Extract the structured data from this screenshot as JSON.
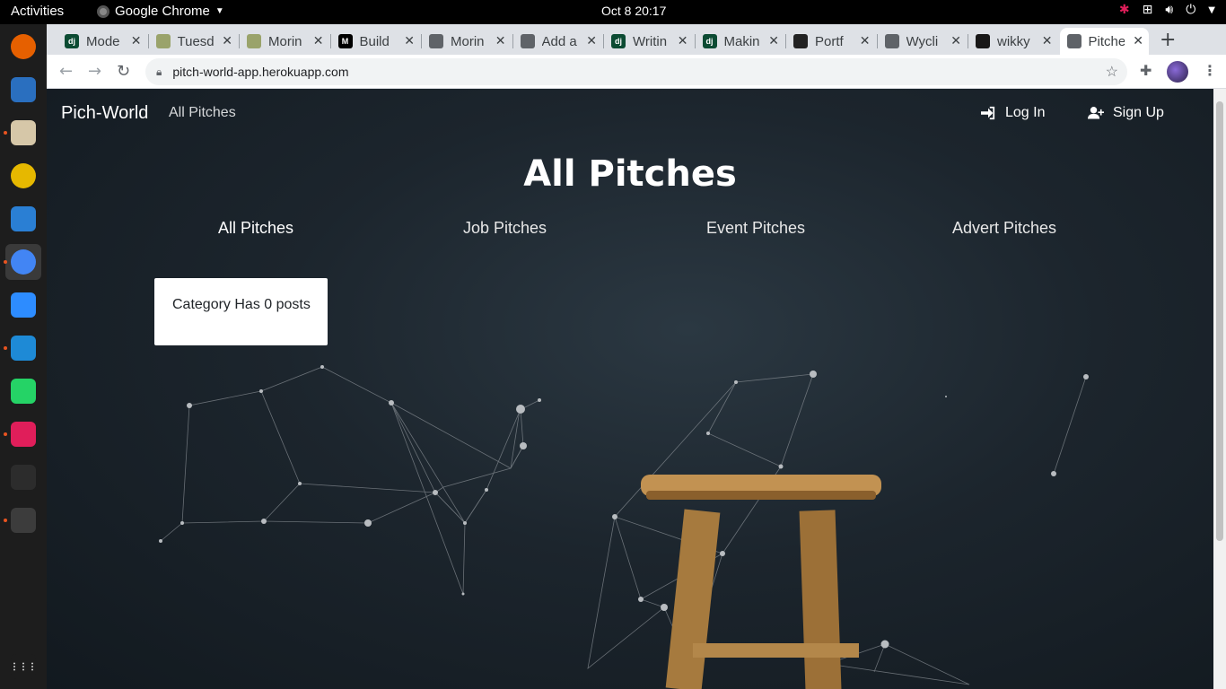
{
  "system": {
    "activities": "Activities",
    "app_menu": "Google Chrome",
    "clock": "Oct 8  20:17"
  },
  "dock": [
    {
      "name": "firefox-icon",
      "color": "#e66000",
      "dot": false
    },
    {
      "name": "thunderbird-icon",
      "color": "#2a6fbf",
      "dot": false
    },
    {
      "name": "files-icon",
      "color": "#d6c7a8",
      "dot": true
    },
    {
      "name": "rhythmbox-icon",
      "color": "#e6b800",
      "dot": false
    },
    {
      "name": "libreoffice-writer-icon",
      "color": "#2a7fd4",
      "dot": false
    },
    {
      "name": "chrome-icon",
      "color": "#4285f4",
      "dot": true,
      "active": true
    },
    {
      "name": "zoom-icon",
      "color": "#2d8cff",
      "dot": false
    },
    {
      "name": "vscode-icon",
      "color": "#1e8ad6",
      "dot": true
    },
    {
      "name": "whatsapp-icon",
      "color": "#25d366",
      "dot": false
    },
    {
      "name": "slack-icon",
      "color": "#e01e5a",
      "dot": true
    },
    {
      "name": "figma-icon",
      "color": "#2c2c2c",
      "dot": false
    },
    {
      "name": "terminal-icon",
      "color": "#3c3c3c",
      "dot": true
    },
    {
      "name": "show-apps-icon",
      "color": "#1d1d1d",
      "dot": false
    }
  ],
  "tabs": [
    {
      "label": "Mode",
      "favicon": "dj",
      "color": "#0c4b33"
    },
    {
      "label": "Tuesd",
      "favicon": "",
      "color": "#9aa36b"
    },
    {
      "label": "Morin",
      "favicon": "",
      "color": "#9aa36b"
    },
    {
      "label": "Build",
      "favicon": "M",
      "color": "#000000"
    },
    {
      "label": "Morin",
      "favicon": "",
      "color": "#5f6368"
    },
    {
      "label": "Add a",
      "favicon": "",
      "color": "#5f6368"
    },
    {
      "label": "Writin",
      "favicon": "dj",
      "color": "#0c4b33"
    },
    {
      "label": "Makin",
      "favicon": "dj",
      "color": "#0c4b33"
    },
    {
      "label": "Portf",
      "favicon": "",
      "color": "#222222"
    },
    {
      "label": "Wycli",
      "favicon": "",
      "color": "#5f6368"
    },
    {
      "label": "wikky",
      "favicon": "",
      "color": "#181717"
    },
    {
      "label": "Pitche",
      "favicon": "",
      "color": "#5f6368",
      "active": true
    }
  ],
  "browser": {
    "url": "pitch-world-app.herokuapp.com"
  },
  "site": {
    "brand": "Pich-World",
    "nav_all": "All Pitches",
    "login": "Log In",
    "signup": "Sign Up",
    "title": "All Pitches",
    "categories": [
      "All Pitches",
      "Job Pitches",
      "Event Pitches",
      "Advert Pitches"
    ],
    "empty_message": "Category Has 0 posts"
  }
}
